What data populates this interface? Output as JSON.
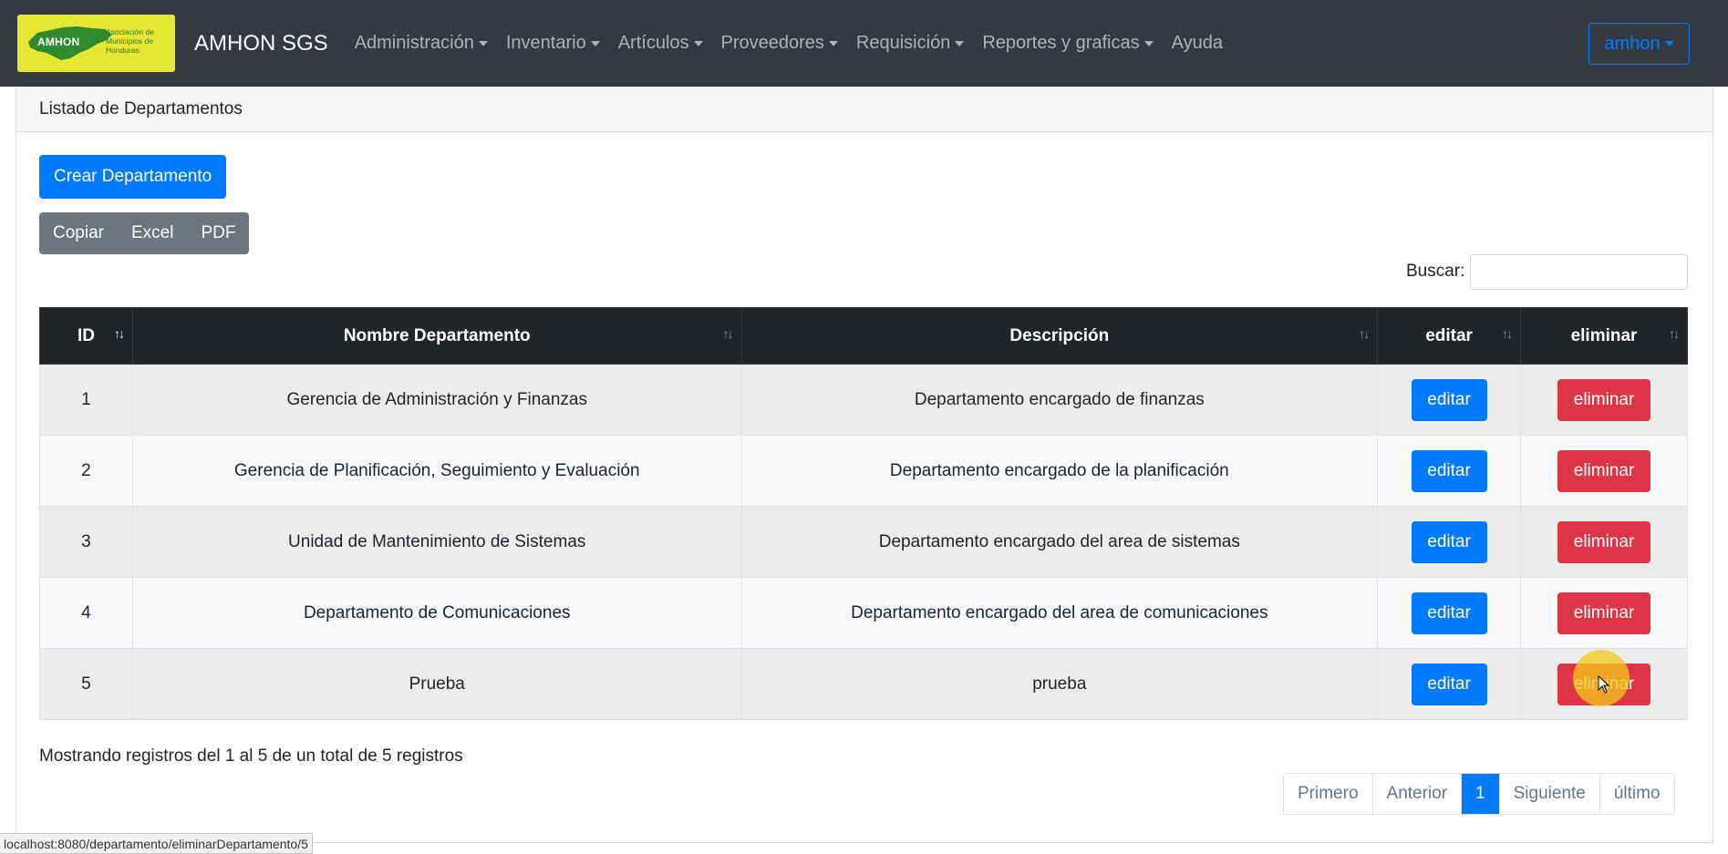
{
  "navbar": {
    "logo_text": "AMHON",
    "logo_subtitle": "Asociación de Municipios de Honduras",
    "brand": "AMHON SGS",
    "items": [
      {
        "label": "Administración",
        "dropdown": true
      },
      {
        "label": "Inventario",
        "dropdown": true
      },
      {
        "label": "Artículos",
        "dropdown": true
      },
      {
        "label": "Proveedores",
        "dropdown": true
      },
      {
        "label": "Requisición",
        "dropdown": true
      },
      {
        "label": "Reportes y graficas",
        "dropdown": true
      },
      {
        "label": "Ayuda",
        "dropdown": false
      }
    ],
    "user": "amhon"
  },
  "card": {
    "header": "Listado de Departamentos",
    "create_button": "Crear Departamento",
    "export_buttons": [
      "Copiar",
      "Excel",
      "PDF"
    ],
    "search_label": "Buscar:",
    "search_value": ""
  },
  "table": {
    "columns": [
      "ID",
      "Nombre Departamento",
      "Descripción",
      "editar",
      "eliminar"
    ],
    "rows": [
      {
        "id": "1",
        "name": "Gerencia de Administración y Finanzas",
        "description": "Departamento encargado de finanzas",
        "edit": "editar",
        "delete": "eliminar"
      },
      {
        "id": "2",
        "name": "Gerencia de Planificación, Seguimiento y Evaluación",
        "description": "Departamento encargado de la planificación",
        "edit": "editar",
        "delete": "eliminar"
      },
      {
        "id": "3",
        "name": "Unidad de Mantenimiento de Sistemas",
        "description": "Departamento encargado del area de sistemas",
        "edit": "editar",
        "delete": "eliminar"
      },
      {
        "id": "4",
        "name": "Departamento de Comunicaciones",
        "description": "Departamento encargado del area de comunicaciones",
        "edit": "editar",
        "delete": "eliminar"
      },
      {
        "id": "5",
        "name": "Prueba",
        "description": "prueba",
        "edit": "editar",
        "delete": "eliminar"
      }
    ]
  },
  "footer": {
    "info": "Mostrando registros del 1 al 5 de un total de 5 registros",
    "pagination": [
      "Primero",
      "Anterior",
      "1",
      "Siguiente",
      "último"
    ],
    "active_page": "1"
  },
  "status_bar": {
    "url": "localhost:8080/departamento/eliminarDepartamento/5"
  },
  "colors": {
    "navbar": "#343a40",
    "primary": "#007bff",
    "danger": "#dc3545",
    "secondary": "#6c757d",
    "table_head": "#212529",
    "logo_bg": "#e6e635"
  }
}
